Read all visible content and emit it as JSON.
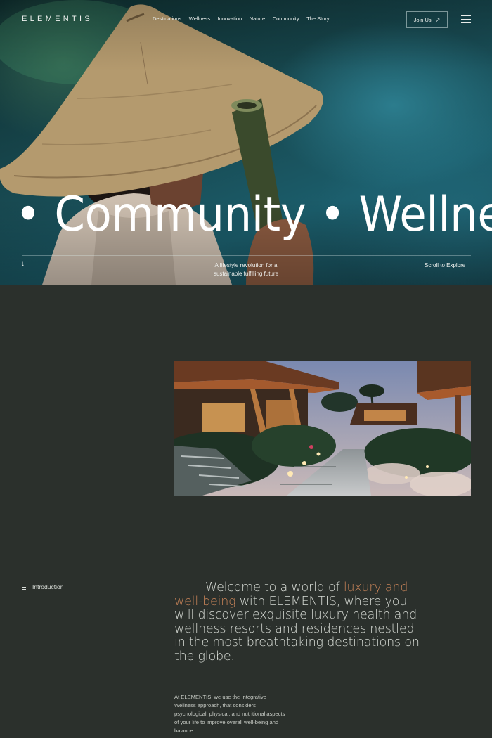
{
  "brand": {
    "logo": "ELEMENTIS"
  },
  "nav": {
    "items": [
      "Destinations",
      "Wellness",
      "Innovation",
      "Nature",
      "Community",
      "The Story"
    ],
    "join_label": "Join Us",
    "join_icon": "arrow-up-right-icon",
    "menu_icon": "hamburger-icon"
  },
  "hero": {
    "marquee": "e • Community • Wellness",
    "tagline": "A lifestyle revolution for a sustainable fulfilling future",
    "scroll_label": "Scroll to Explore",
    "scroll_icon": "arrow-down-icon"
  },
  "intro": {
    "label": "Introduction",
    "headline_pre": "Welcome to a world of ",
    "headline_accent": "luxury and well-being",
    "headline_post": " with ELEMENTIS, where you will discover exquisite luxury health and wellness resorts and residences nestled in the most breathtaking destinations on the globe.",
    "body": "At ELEMENTIS, we use the Integrative Wellness approach, that considers psychological, physical, and nutritional aspects of your life to improve overall well-being and balance."
  },
  "colors": {
    "background": "#2b302c",
    "accent": "#c98459",
    "hero_teal": "#1b5d6b"
  }
}
